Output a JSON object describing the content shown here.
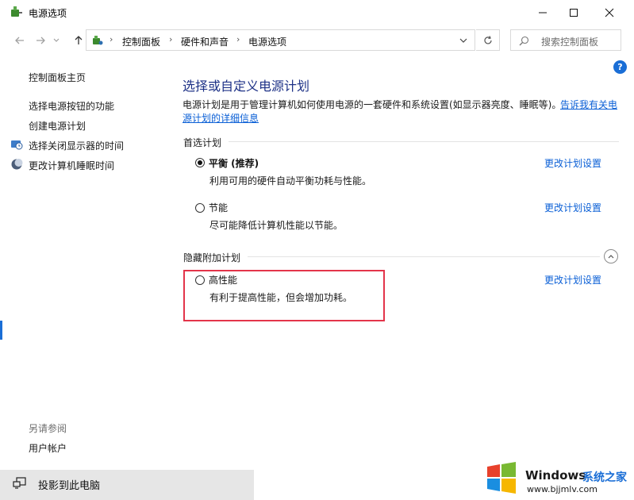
{
  "window": {
    "title": "电源选项",
    "controls": {
      "minimize": "—",
      "maximize": "☐",
      "close": "✕"
    }
  },
  "address_bar": {
    "breadcrumbs": [
      "控制面板",
      "硬件和声音",
      "电源选项"
    ],
    "search_placeholder": "搜索控制面板"
  },
  "sidebar": {
    "home": "控制面板主页",
    "links": [
      "选择电源按钮的功能",
      "创建电源计划",
      "选择关闭显示器的时间",
      "更改计算机睡眠时间"
    ],
    "see_also_title": "另请参阅",
    "see_also_items": [
      "用户帐户"
    ]
  },
  "main": {
    "title": "选择或自定义电源计划",
    "intro_text": "电源计划是用于管理计算机如何使用电源的一套硬件和系统设置(如显示器亮度、睡眠等)。",
    "intro_link_part1": "告诉我有关电",
    "intro_link_part2": "源计划的详细信息",
    "preferred_section": "首选计划",
    "hidden_section": "隐藏附加计划",
    "plans": [
      {
        "name": "平衡 (推荐)",
        "desc": "利用可用的硬件自动平衡功耗与性能。",
        "selected": true,
        "change": "更改计划设置"
      },
      {
        "name": "节能",
        "desc": "尽可能降低计算机性能以节能。",
        "selected": false,
        "change": "更改计划设置"
      },
      {
        "name": "高性能",
        "desc": "有利于提高性能，但会增加功耗。",
        "selected": false,
        "change": "更改计划设置"
      }
    ]
  },
  "taskbar": {
    "item": "投影到此电脑"
  },
  "watermark": {
    "brand": "Windows",
    "cn": "系统之家",
    "url": "www.bjjmlv.com"
  },
  "colors": {
    "accent": "#1a6ed6",
    "title": "#1e3287",
    "link": "#0a5fd6",
    "highlight": "#e3344a"
  }
}
